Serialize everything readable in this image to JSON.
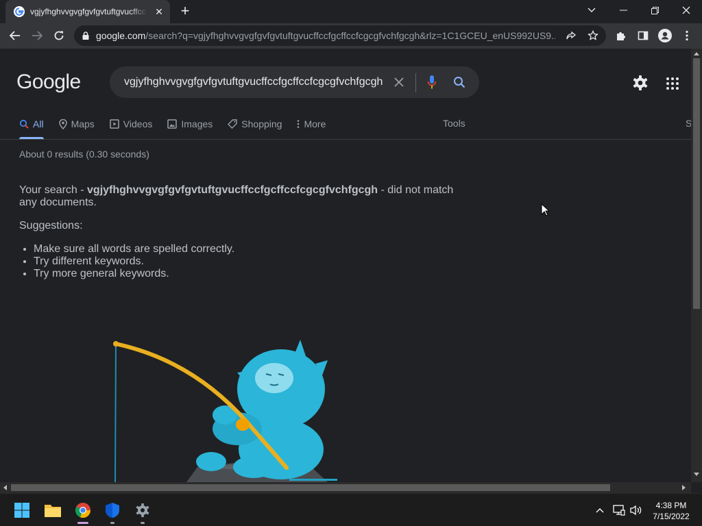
{
  "browser": {
    "tab_title": "vgjyfhghvvgvgfgvfgvtuftgvucffcc",
    "url_host": "google.com",
    "url_path": "/search?q=vgjyfhghvvgvgfgvfgvtuftgvucffccfgcffccfcgcgfvchfgcgh&rlz=1C1GCEU_enUS992US9..."
  },
  "search": {
    "logo": "Google",
    "query": "vgjyfhghvvgvgfgvfgvtuftgvucffccfgcffccfcgcgfvchfgcgh"
  },
  "nav": {
    "items": [
      {
        "label": "All",
        "icon": "search-icon",
        "active": true
      },
      {
        "label": "Maps",
        "icon": "map-pin-icon"
      },
      {
        "label": "Videos",
        "icon": "video-icon"
      },
      {
        "label": "Images",
        "icon": "image-icon"
      },
      {
        "label": "Shopping",
        "icon": "tag-icon"
      },
      {
        "label": "More",
        "icon": "more-vert-icon"
      }
    ],
    "tools": "Tools",
    "cut_off": "S"
  },
  "results": {
    "stats": "About 0 results (0.30 seconds)",
    "msg_prefix": "Your search - ",
    "msg_query": "vgjyfhghvvgvgfgvfgvtuftgvucffccfgcffccfcgcgfvchfgcgh",
    "msg_suffix": " - did not match any documents.",
    "suggestions_heading": "Suggestions:",
    "suggestions": [
      "Make sure all words are spelled correctly.",
      "Try different keywords.",
      "Try more general keywords."
    ]
  },
  "taskbar": {
    "time": "4:38 PM",
    "date": "7/15/2022"
  },
  "colors": {
    "page_bg": "#202124",
    "accent": "#8ab4f8",
    "yeti": "#2bb5d8"
  }
}
